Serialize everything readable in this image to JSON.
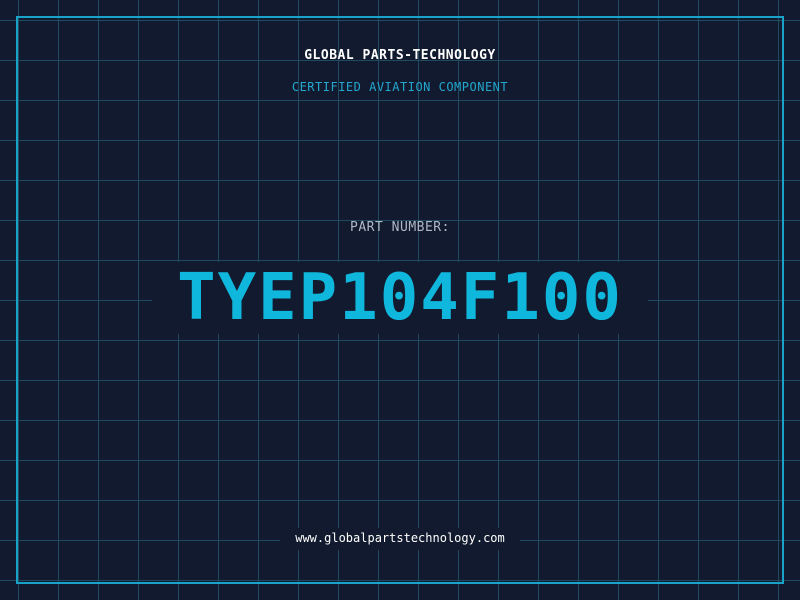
{
  "header": {
    "company": "GLOBAL PARTS-TECHNOLOGY",
    "subtitle": "CERTIFIED AVIATION COMPONENT"
  },
  "part": {
    "label": "PART NUMBER:",
    "number": "TYEP104F100"
  },
  "footer": {
    "website": "www.globalpartstechnology.com"
  },
  "colors": {
    "background": "#111a2e",
    "grid": "#1f4a5f",
    "frame": "#1aa3c9",
    "accent": "#10b7dc",
    "subtitle": "#24a7cf",
    "label": "#aeb8c6",
    "text": "#ffffff"
  }
}
